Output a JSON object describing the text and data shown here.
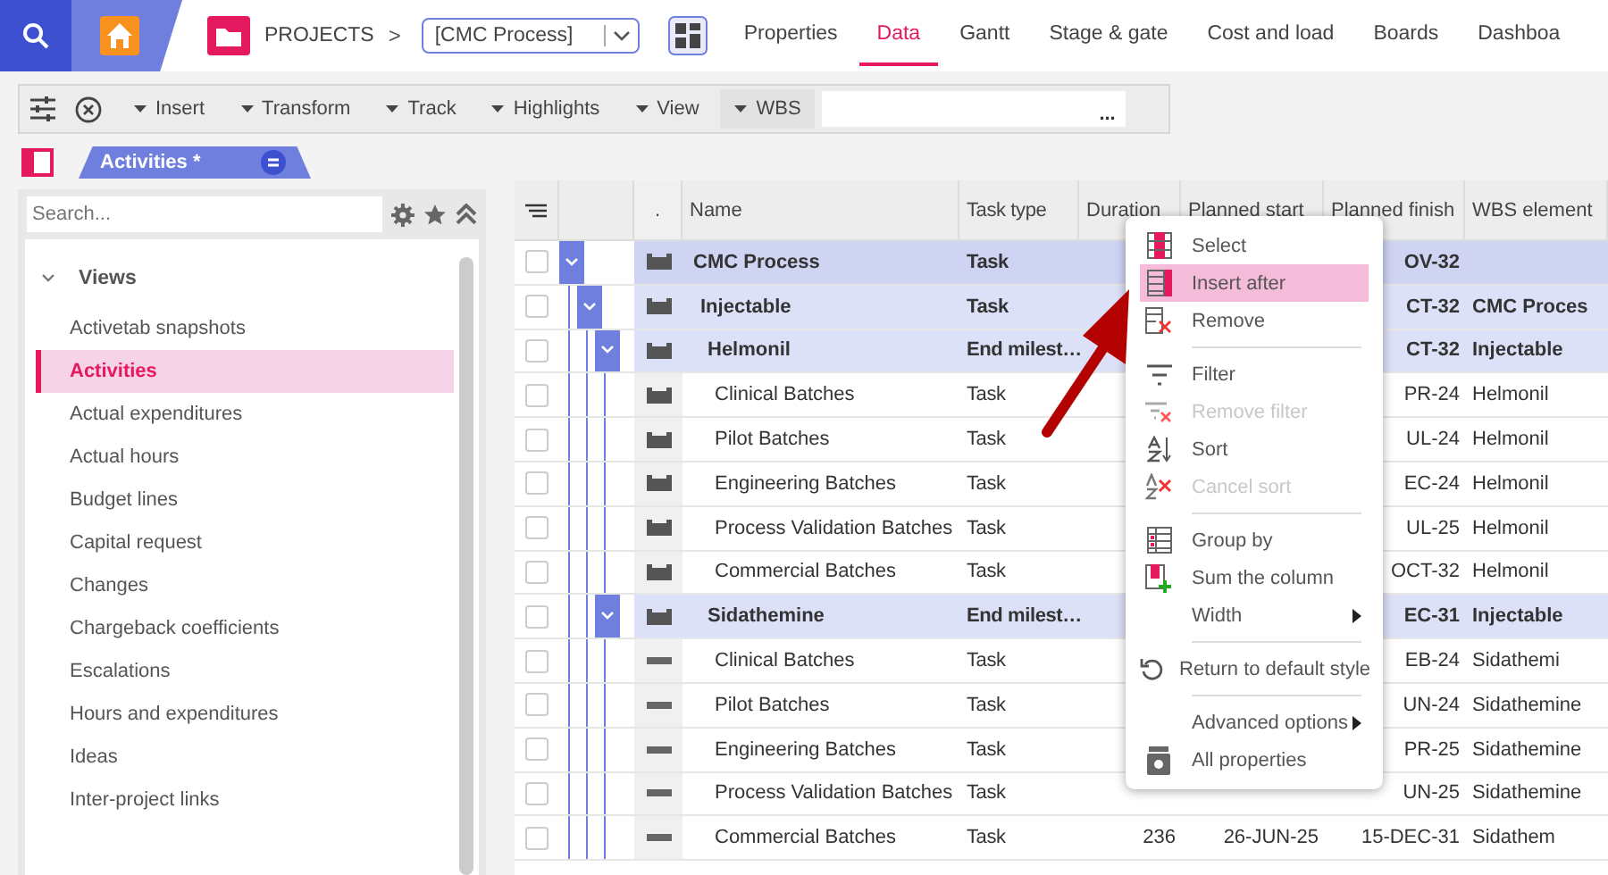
{
  "header": {
    "section": "PROJECTS",
    "separator": ">",
    "project": "[CMC Process]",
    "tabs": [
      {
        "label": "Properties",
        "selected": false
      },
      {
        "label": "Data",
        "selected": true
      },
      {
        "label": "Gantt",
        "selected": false
      },
      {
        "label": "Stage & gate",
        "selected": false
      },
      {
        "label": "Cost and load",
        "selected": false
      },
      {
        "label": "Boards",
        "selected": false
      },
      {
        "label": "Dashboa",
        "selected": false
      }
    ]
  },
  "toolbar": {
    "menus": [
      "Insert",
      "Transform",
      "Track",
      "Highlights",
      "View"
    ],
    "wbs_label": "WBS",
    "wbs_more": "..."
  },
  "view_tab": {
    "label": "Activities *"
  },
  "sidebar": {
    "search": {
      "placeholder": "Search..."
    },
    "group": {
      "label": "Views",
      "expanded": true
    },
    "items": [
      {
        "label": "Activetab snapshots",
        "selected": false
      },
      {
        "label": "Activities",
        "selected": true
      },
      {
        "label": "Actual expenditures",
        "selected": false
      },
      {
        "label": "Actual hours",
        "selected": false
      },
      {
        "label": "Budget lines",
        "selected": false
      },
      {
        "label": "Capital request",
        "selected": false
      },
      {
        "label": "Changes",
        "selected": false
      },
      {
        "label": "Chargeback coefficients",
        "selected": false
      },
      {
        "label": "Escalations",
        "selected": false
      },
      {
        "label": "Hours and expenditures",
        "selected": false
      },
      {
        "label": "Ideas",
        "selected": false
      },
      {
        "label": "Inter-project links",
        "selected": false
      }
    ]
  },
  "table": {
    "columns": [
      ".",
      "Name",
      "Task type",
      "Duration",
      "Planned start",
      "Planned finish",
      "WBS element"
    ],
    "rows": [
      {
        "kind": "summary",
        "checked": false,
        "name": "CMC Process",
        "task_type": "Task",
        "planned_finish": "OV-32",
        "expanded": true,
        "children": [
          {
            "kind": "summary",
            "checked": false,
            "name": "Injectable",
            "task_type": "Task",
            "planned_finish": "CT-32",
            "wbs": "CMC Proces",
            "expanded": true,
            "children": [
              {
                "kind": "summary",
                "checked": false,
                "name": "Helmonil",
                "task_type": "End milest…",
                "planned_finish": "CT-32",
                "wbs": "Injectable",
                "expanded": true,
                "children": [
                  {
                    "kind": "summary",
                    "checked": false,
                    "name": "Clinical Batches",
                    "task_type": "Task",
                    "planned_finish": "PR-24",
                    "wbs": "Helmonil"
                  },
                  {
                    "kind": "summary",
                    "checked": false,
                    "name": "Pilot Batches",
                    "task_type": "Task",
                    "planned_finish": "UL-24",
                    "wbs": "Helmonil"
                  },
                  {
                    "kind": "summary",
                    "checked": false,
                    "name": "Engineering Batches",
                    "task_type": "Task",
                    "planned_finish": "EC-24",
                    "wbs": "Helmonil"
                  },
                  {
                    "kind": "summary",
                    "checked": false,
                    "name": "Process Validation Batches",
                    "task_type": "Task",
                    "planned_finish": "UL-25",
                    "wbs": "Helmonil"
                  },
                  {
                    "kind": "summary",
                    "checked": false,
                    "name": "Commercial Batches",
                    "task_type": "Task",
                    "planned_finish": "OCT-32",
                    "wbs": "Helmonil"
                  }
                ]
              },
              {
                "kind": "summary",
                "checked": false,
                "name": "Sidathemine",
                "task_type": "End milest…",
                "planned_finish": "EC-31",
                "wbs": "Injectable",
                "expanded": true,
                "children": [
                  {
                    "kind": "plain",
                    "checked": false,
                    "name": "Clinical Batches",
                    "task_type": "Task",
                    "planned_finish": "EB-24",
                    "wbs": "Sidathemi"
                  },
                  {
                    "kind": "plain",
                    "checked": false,
                    "name": "Pilot Batches",
                    "task_type": "Task",
                    "planned_finish": "UN-24",
                    "wbs": "Sidathemine"
                  },
                  {
                    "kind": "plain",
                    "checked": false,
                    "name": "Engineering Batches",
                    "task_type": "Task",
                    "planned_finish": "PR-25",
                    "wbs": "Sidathemine"
                  },
                  {
                    "kind": "plain",
                    "checked": false,
                    "name": "Process Validation Batches",
                    "task_type": "Task",
                    "planned_finish": "UN-25",
                    "wbs": "Sidathemine"
                  },
                  {
                    "kind": "plain",
                    "checked": false,
                    "name": "Commercial Batches",
                    "task_type": "Task",
                    "duration": "236",
                    "planned_start": "26-JUN-25",
                    "planned_finish": "15-DEC-31",
                    "wbs": "Sidathem"
                  }
                ]
              }
            ]
          }
        ]
      }
    ]
  },
  "context_menu": [
    {
      "kind": "item",
      "label": "Select",
      "selected": false,
      "disabled": false
    },
    {
      "kind": "item",
      "label": "Insert after",
      "selected": true,
      "disabled": false
    },
    {
      "kind": "item",
      "label": "Remove",
      "selected": false,
      "disabled": false
    },
    {
      "kind": "separator"
    },
    {
      "kind": "item",
      "label": "Filter",
      "selected": false,
      "disabled": false
    },
    {
      "kind": "item",
      "label": "Remove filter",
      "selected": false,
      "disabled": true
    },
    {
      "kind": "item",
      "label": "Sort",
      "selected": false,
      "disabled": false
    },
    {
      "kind": "item",
      "label": "Cancel sort",
      "selected": false,
      "disabled": true
    },
    {
      "kind": "separator"
    },
    {
      "kind": "item",
      "label": "Group by",
      "selected": false,
      "disabled": false
    },
    {
      "kind": "item",
      "label": "Sum the column",
      "selected": false,
      "disabled": false
    },
    {
      "kind": "item",
      "label": "Width",
      "selected": false,
      "disabled": false,
      "submenu": true
    },
    {
      "kind": "separator"
    },
    {
      "kind": "item",
      "label": "Return to default style",
      "selected": false,
      "disabled": false
    },
    {
      "kind": "separator"
    },
    {
      "kind": "item",
      "label": "Advanced options",
      "selected": false,
      "disabled": false,
      "submenu": true
    },
    {
      "kind": "item",
      "label": "All properties",
      "selected": false,
      "disabled": false
    }
  ]
}
